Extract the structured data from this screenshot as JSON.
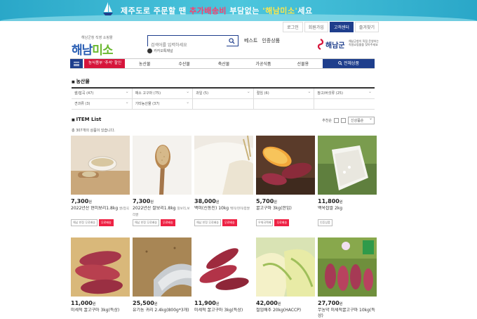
{
  "banner": {
    "slogan_a": "제주도로 주문할 땐 ",
    "slogan_b": "추가배송비",
    "slogan_c": " 부담없는 ",
    "slogan_d": "'해남미소'",
    "slogan_e": "세요"
  },
  "toplinks": [
    "로그인",
    "회원가입",
    "고객센터",
    "즐겨찾기"
  ],
  "logo": {
    "small": "해남군청 직영 쇼핑몰",
    "main_a": "해남",
    "main_b": "미소"
  },
  "search": {
    "placeholder": "검색어를 입력하세요"
  },
  "hashtag": {
    "label": "카카오톡채널"
  },
  "quick": [
    "베스트",
    "인증상품"
  ],
  "county": {
    "name": "해남군",
    "sub": "해남군청이 직접 운영하는 직영쇼핑몰을 찾아주세요"
  },
  "nav": {
    "promo": "농식품부 '추석' 할인",
    "items": [
      "농산물",
      "수산물",
      "축산물",
      "가공식품",
      "선물용"
    ],
    "all": "전체상품"
  },
  "section": {
    "title": "농산물"
  },
  "filters": {
    "row1": [
      "쌀/잡곡 (47)",
      "채소 고구마 (75)",
      "과일 (5)",
      "절임 (6)",
      "참고/버섯류 (25)"
    ],
    "row2": [
      "견과류 (3)",
      "기타농산물 (37)",
      "",
      "",
      ""
    ]
  },
  "item_list": {
    "title": "ITEM List",
    "sort_label": "추천순",
    "sort_value": "신상품순",
    "count_text": "총 307개의 상품이 있습니다."
  },
  "products": [
    {
      "price": "7,300",
      "won": "원",
      "name": "2022년산 현미보리1.8kg",
      "sub": "쌀/잡곡",
      "tags": [
        "해남 한정 무료배송",
        "무료배송"
      ],
      "img": "barley"
    },
    {
      "price": "7,300",
      "won": "원",
      "name": "2022년산 찰보리1.8kg",
      "sub": "찰보리,보리쌀",
      "tags": [
        "해남 한정 무료배송",
        "무료배송"
      ],
      "img": "grain"
    },
    {
      "price": "38,000",
      "won": "원",
      "name": "백미(신동진) 10kg",
      "sub": "백미/현미/찹쌀",
      "tags": [
        "해남 한정 무료배송",
        "무료배송"
      ],
      "img": "rice"
    },
    {
      "price": "5,700",
      "won": "원",
      "name": "꿀고구마 3kg(한입)",
      "sub": "",
      "tags": [
        "우체국택배",
        "무료배송"
      ],
      "img": "sweetpotato"
    },
    {
      "price": "11,800",
      "won": "원",
      "name": "백옥찹쌀 2kg",
      "sub": "",
      "tags": [
        "인증상품"
      ],
      "img": "sack"
    },
    {
      "price": "11,000",
      "won": "원",
      "name": "미세척 꿀고구마 3kg(특상)",
      "sub": "",
      "tags": [],
      "img": "sweetpotato2"
    },
    {
      "price": "25,500",
      "won": "원",
      "name": "유기농 귀리 2.4kg(800g*3개)",
      "sub": "",
      "tags": [],
      "img": "oat"
    },
    {
      "price": "11,900",
      "won": "원",
      "name": "미세척 꿀고구마 3kg(특상)",
      "sub": "",
      "tags": [],
      "img": "sweetpotato3"
    },
    {
      "price": "42,000",
      "won": "원",
      "name": "절임배추 20kg(HACCP)",
      "sub": "",
      "tags": [],
      "img": "cabbage"
    },
    {
      "price": "27,700",
      "won": "원",
      "name": "무농약 미세척꿀고구마 10kg(특상)",
      "sub": "",
      "tags": [],
      "img": "organic"
    }
  ],
  "colors": {
    "navy": "#1e3e8c",
    "promo_red": "#d6153b",
    "banner": "#2aa7c8"
  }
}
